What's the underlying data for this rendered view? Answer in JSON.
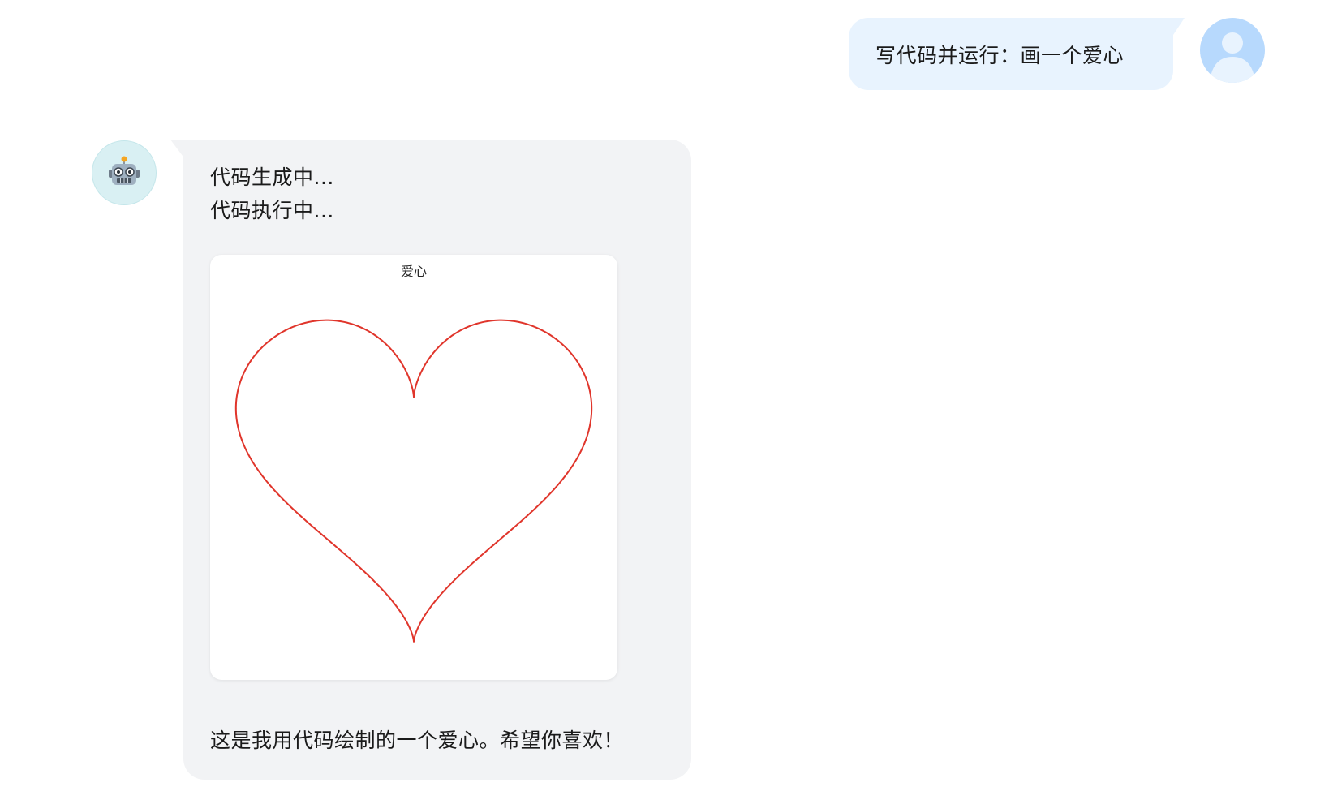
{
  "user_message": {
    "text": "写代码并运行：画一个爱心",
    "avatar_icon": "user-silhouette-icon"
  },
  "bot_message": {
    "avatar_icon": "robot-icon",
    "status_lines": [
      "代码生成中...",
      "代码执行中..."
    ],
    "result_image": {
      "title": "爱心",
      "shape": "heart-curve",
      "line_color": "#e0352b"
    },
    "closing_text": "这是我用代码绘制的一个爱心。希望你喜欢！"
  },
  "colors": {
    "user_bubble": "#e8f3fe",
    "user_avatar": "#b7d9fd",
    "bot_bubble": "#f2f3f5",
    "bot_avatar": "#d9f0f3"
  }
}
